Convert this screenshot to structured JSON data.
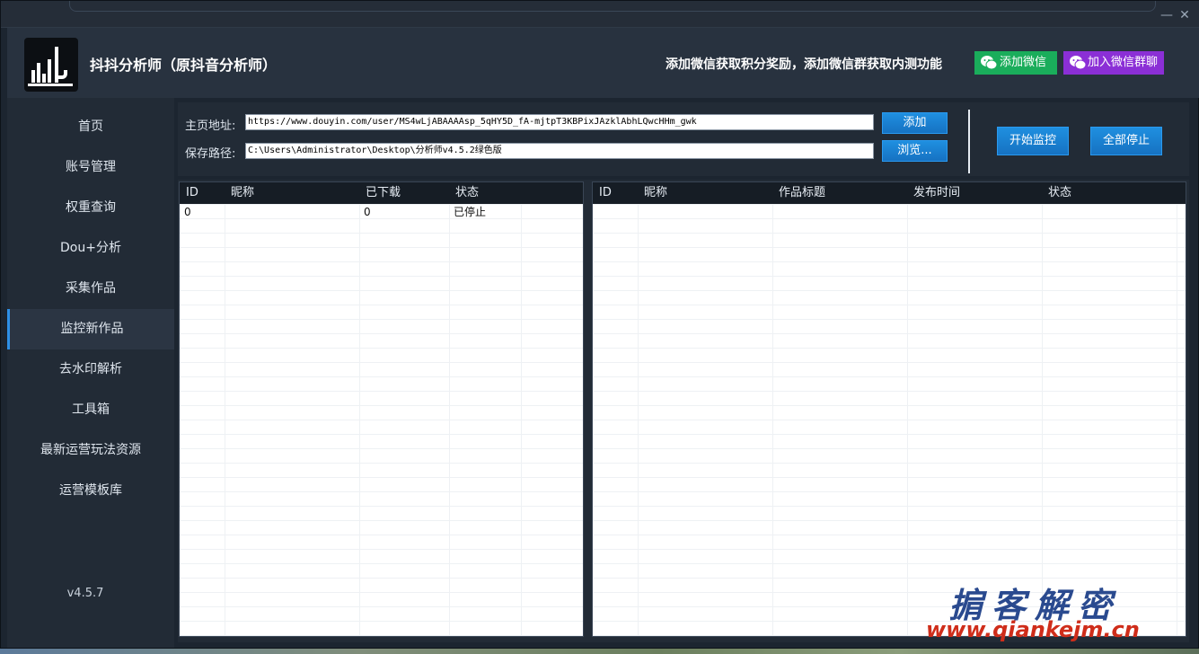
{
  "window": {
    "minimize_icon": "minimize-icon",
    "close_icon": "close-icon",
    "minimize_glyph": "—",
    "close_glyph": "✕"
  },
  "header": {
    "title": "抖抖分析师（原抖音分析师）",
    "promo_text": "添加微信获取积分奖励，添加微信群获取内测功能",
    "wechat_button": "添加微信",
    "group_button": "加入微信群聊",
    "wechat_color": "#1aad5b",
    "group_color": "#8b2fd6"
  },
  "sidebar": {
    "items": [
      {
        "label": "首页"
      },
      {
        "label": "账号管理"
      },
      {
        "label": "权重查询"
      },
      {
        "label": "Dou+分析"
      },
      {
        "label": "采集作品"
      },
      {
        "label": "监控新作品",
        "active": true
      },
      {
        "label": "去水印解析"
      },
      {
        "label": "工具箱"
      },
      {
        "label": "最新运营玩法资源"
      },
      {
        "label": "运营模板库"
      }
    ],
    "version": "v4.5.7",
    "accent": "#2e90e6"
  },
  "form": {
    "homepage_label": "主页地址:",
    "homepage_value": "https://www.douyin.com/user/MS4wLjABAAAAsp_5qHY5D_fA-mjtpT3KBPixJAzklAbhLQwcHHm_gwk",
    "save_label": "保存路径:",
    "save_value": "C:\\Users\\Administrator\\Desktop\\分析师v4.5.2绿色版",
    "add_button": "添加",
    "browse_button": "浏览...",
    "start_button": "开始监控",
    "stop_button": "全部停止"
  },
  "left_table": {
    "columns": [
      "ID",
      "昵称",
      "已下载",
      "状态"
    ],
    "rows": [
      [
        "0",
        "",
        "0",
        "已停止"
      ]
    ]
  },
  "right_table": {
    "columns": [
      "ID",
      "昵称",
      "作品标题",
      "发布时间",
      "状态"
    ],
    "rows": []
  },
  "watermark": {
    "line1": "掮客解密",
    "line2": "www.qiankejm.cn"
  }
}
